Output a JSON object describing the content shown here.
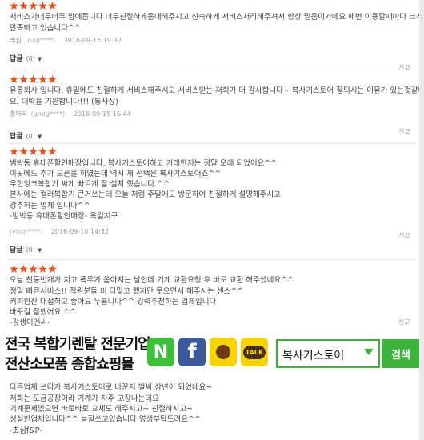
{
  "reviews": [
    {
      "stars": 5,
      "lines": [
        "서비스가너무너무 맘에듭니다 너무친절하게응대해주시고 신속하게 서비스처리해주셔서 항상 믿음이가네요 매번 이용할때마다 크게",
        "만족하고 있습니다^^"
      ],
      "author": "멕심",
      "uid": "(ruip****)",
      "date": "2016-09-15 19:32",
      "reply_label": "답글",
      "reply_count": "(0)",
      "report": "신고"
    },
    {
      "stars": 5,
      "lines": [
        "유통회사 입니다. 휴일에도 친절하게 서비스해주시고 서비스받는 저희가 더 감사합니다~ 복사기스토어 잘되시는 이유가 있는것같네",
        "요. 대박을 기원합니다!!! (통사장)"
      ],
      "author": "총아리",
      "uid": "(qhdg****)",
      "date": "2016-09-15 16:44",
      "reply_label": "답글",
      "reply_count": "(0)",
      "report": "신고"
    },
    {
      "stars": 5,
      "lines": [
        "범박동 휴대폰할인매장입니다. 복사기스토어하고 거래한지는 정말 오래 되었어요^^",
        "이곳에도 추가 오픈을 하였는데 역시 제 선택은 복사기스토어죠^^",
        "무한잉크복합기 싸게 빠르게 잘 설치 했습니다.^^",
        "본사에는 컬러복합기 큰거쓰는데 오늘 처럼 주말에도 방문하여 친절하게 설명해주시고",
        "강추하는 업체 입니다^^",
        "-범박동 휴대폰할인매장- 옥길지구"
      ],
      "author": "",
      "uid": "(yhsh****)",
      "date": "2016-09-10 14:32",
      "reply_label": "답글",
      "reply_count": "(0)",
      "report": "신고"
    },
    {
      "stars": 5,
      "lines": [
        "오늘 천둥번개가 치고 폭우가 쏟아지는 날인데 기계 교환요청 후 바로 교환 해주셨네요^^",
        "정말 빠른서비스!! 직원분들 비 다맞고 했지만 웃으면서 해주시는 센스^^",
        "커피한잔 대접하고 좋아요 누릅니다^^ 강력추천하는 업체입니다",
        "바꾸길 잘했어요 ^^",
        "-강생이엔씨-"
      ],
      "report": "신고"
    },
    {
      "stars": 0,
      "lines": [
        "다른업체 쓰다가 복사기스토어로 바꾼지 벌써 삼년이 되었네요~",
        "저희는 도금공장이라 기계가 자주 고장나는데요",
        "기계문제있으면 바로바로 교체도 해주시고~ 친절하시고~",
        "성실한업체입니다^^ 늘잘쓰고있습니다 명생부탁드려요^^",
        "-초심f&P-"
      ]
    }
  ],
  "banner": {
    "title_line1": "전국 복합기렌탈 전문기업",
    "title_line2": "전산소모품 종합쇼핑몰",
    "naver_letter": "N",
    "facebook_letter": "f",
    "kakao_talk_label": "TALK",
    "search_value": "복사기스토어",
    "search_button": "검색",
    "accent_color": "#3cb43c"
  }
}
